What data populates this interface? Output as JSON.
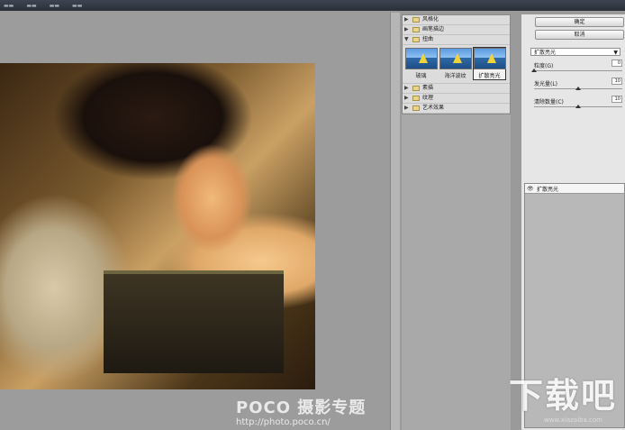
{
  "gallery": {
    "categories_top": [
      "风格化",
      "画笔描边",
      "扭曲"
    ],
    "thumbnails": [
      {
        "label": "玻璃",
        "selected": false
      },
      {
        "label": "海洋波纹",
        "selected": false
      },
      {
        "label": "扩散亮光",
        "selected": true
      }
    ],
    "categories_bottom": [
      "素描",
      "纹理",
      "艺术效果"
    ]
  },
  "settings": {
    "ok_label": "确定",
    "cancel_label": "取消",
    "filter_selected": "扩散亮光",
    "params": [
      {
        "label": "粒度(G)",
        "value": "0",
        "fraction": 0.0
      },
      {
        "label": "发光量(L)",
        "value": "10",
        "fraction": 0.5
      },
      {
        "label": "清除数量(C)",
        "value": "10",
        "fraction": 0.5
      }
    ],
    "layer_name": "扩散亮光"
  },
  "watermark": {
    "title": "POCO 摄影专题",
    "url": "http://photo.poco.cn/"
  },
  "site_watermark": {
    "title": "下载吧",
    "url": "www.xiazaiba.com"
  }
}
